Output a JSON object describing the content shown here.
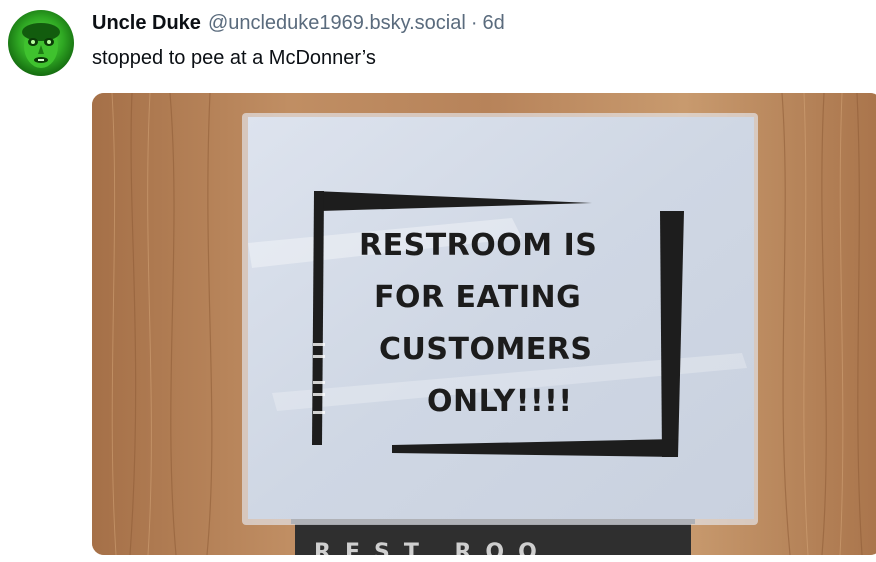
{
  "post": {
    "author": {
      "display_name": "Uncle Duke",
      "handle": "@uncleduke1969.bsky.social"
    },
    "separator": "·",
    "timestamp": "6d",
    "text": "stopped to pee at a McDonner’s",
    "image": {
      "sign_lines": [
        "RESTROOM IS",
        "FOR EATING",
        "CUSTOMERS",
        "ONLY!!!!"
      ],
      "plaque_text": "REST ROO"
    }
  },
  "colors": {
    "text_primary": "#0b0f14",
    "text_secondary": "#5a6b7d",
    "avatar_green": "#2fa823",
    "wood": "#b9855a"
  },
  "icons": {
    "avatar": "green-face-avatar"
  }
}
